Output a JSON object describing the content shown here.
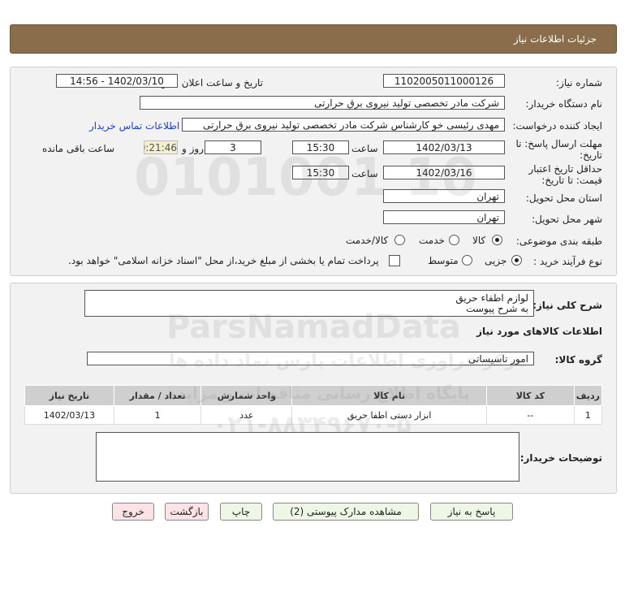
{
  "header": {
    "title": "جزئیات اطلاعات نیاز"
  },
  "form": {
    "need_number_label": "شماره نیاز:",
    "need_number": "1102005011000126",
    "announce_label": "تاریخ و ساعت اعلان عمومی:",
    "announce_value": "1402/03/10 - 14:56",
    "buyer_org_label": "نام دستگاه خریدار:",
    "buyer_org": "شرکت مادر تخصصی تولید نیروی برق حرارتی",
    "creator_label": "ایجاد کننده درخواست:",
    "creator": "مهدی رئیسی خو کارشناس شرکت مادر تخصصی تولید نیروی برق حرارتی",
    "contact_link": "اطلاعات تماس خریدار",
    "deadline_label_1": "مهلت ارسال پاسخ: تا",
    "deadline_label_2": "تاریخ:",
    "deadline_date": "1402/03/13",
    "time_label": "ساعت",
    "deadline_time": "15:30",
    "days_value": "3",
    "days_label": "روز و",
    "remaining_time": "00:21:46",
    "remaining_label": "ساعت باقی مانده",
    "validity_label_1": "حداقل تاریخ اعتبار",
    "validity_label_2": "قیمت: تا تاریخ:",
    "validity_date": "1402/03/16",
    "validity_time": "15:30",
    "province_label": "استان محل تحویل:",
    "province": "تهران",
    "city_label": "شهر محل تحویل:",
    "city": "تهران",
    "category_label": "طبقه بندی موضوعی:",
    "category_options": [
      "کالا",
      "خدمت",
      "کالا/خدمت"
    ],
    "process_label": "نوع فرآیند خرید :",
    "process_options": [
      "جزیی",
      "متوسط"
    ],
    "payment_note": "پرداخت تمام یا بخشی از مبلغ خرید،از محل \"اسناد خزانه اسلامی\" خواهد بود."
  },
  "details": {
    "summary_label": "شرح کلی نیاز:",
    "summary_line1": "لوازم اطفاء حریق",
    "summary_line2": "به شرح پیوست",
    "goods_info_title": "اطلاعات کالاهای مورد نیاز",
    "goods_group_label": "گروه کالا:",
    "goods_group": "امور تاسیساتی",
    "table_headers": [
      "ردیف",
      "کد کالا",
      "نام کالا",
      "واحد شمارش",
      "تعداد / مقدار",
      "تاریخ نیاز"
    ],
    "table_rows": [
      [
        "1",
        "--",
        "ابزار دستی اطفا حریق",
        "عدد",
        "1",
        "1402/03/13"
      ]
    ],
    "buyer_notes_label": "توضیحات خریدار:"
  },
  "buttons": {
    "reply": "پاسخ به نیاز",
    "attachments": "مشاهده مدارک پیوستی (2)",
    "print": "چاپ",
    "back": "بازگشت",
    "exit": "خروج"
  },
  "watermark": {
    "brand": "ParsNamadData",
    "line1": "مرکز فراوری اطلاعات پارس نماد داده ها",
    "line2": "پایگاه اطلاع رسانی مناقصات و مزایده",
    "phone": "۰۲۱-۸۸۳۴۹۶۷۰-۵",
    "digits": "0101001 10"
  }
}
